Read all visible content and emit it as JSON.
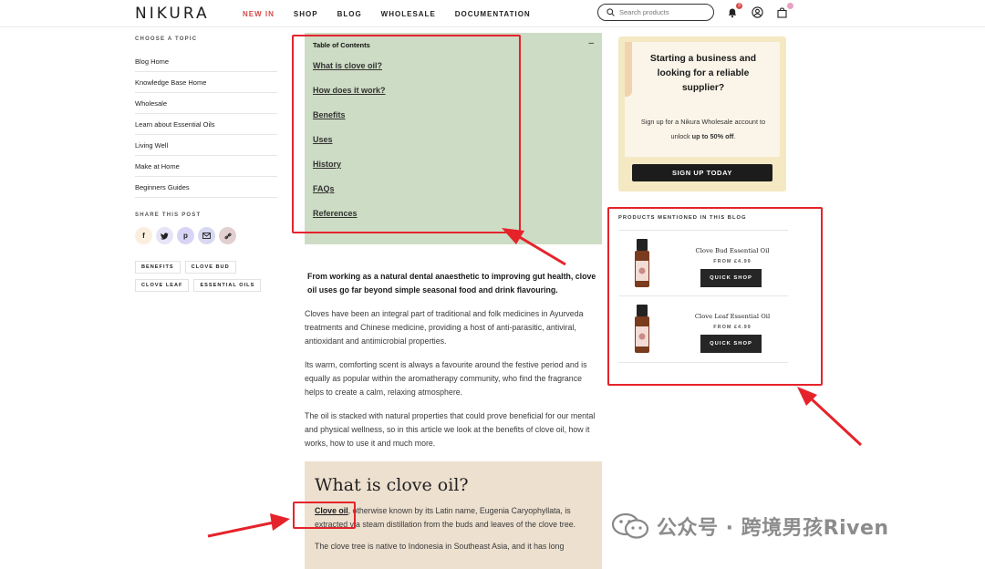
{
  "header": {
    "logo": "NIKURA",
    "nav": [
      {
        "label": "NEW IN",
        "active": true
      },
      {
        "label": "SHOP",
        "active": false
      },
      {
        "label": "BLOG",
        "active": false
      },
      {
        "label": "WHOLESALE",
        "active": false
      },
      {
        "label": "DOCUMENTATION",
        "active": false
      }
    ],
    "search_placeholder": "Search products",
    "notification_count": "3",
    "accent_color": "#d64a4a"
  },
  "sidebar": {
    "topic_heading": "CHOOSE A TOPIC",
    "topics": [
      "Blog Home",
      "Knowledge Base Home",
      "Wholesale",
      "Learn about Essential Oils",
      "Living Well",
      "Make at Home",
      "Beginners Guides"
    ],
    "share_heading": "SHARE THIS POST",
    "share_icons": [
      "facebook-icon",
      "twitter-icon",
      "pinterest-icon",
      "email-icon",
      "link-icon"
    ],
    "tags": [
      "BENEFITS",
      "CLOVE BUD",
      "CLOVE LEAF",
      "ESSENTIAL OILS"
    ]
  },
  "toc": {
    "title": "Table of Contents",
    "collapse": "–",
    "links": [
      "What is clove oil?",
      "How does it work?",
      "Benefits",
      "Uses",
      "History",
      "FAQs",
      "References"
    ],
    "background": "#cddcc4"
  },
  "article": {
    "lead": "From working as a natural dental anaesthetic to improving gut health, clove oil uses go far beyond simple seasonal food and drink flavouring.",
    "paragraphs": [
      "Cloves have been an integral part of traditional and folk medicines in Ayurveda treatments and Chinese medicine, providing a host of anti-parasitic, antiviral, antioxidant and antimicrobial properties.",
      "Its warm, comforting scent is always a favourite around the festive period and is equally as popular within the aromatherapy community, who find the fragrance helps to create a calm, relaxing atmosphere.",
      "The oil is stacked with natural properties that could prove beneficial for our mental and physical wellness, so in this article we look at the benefits of clove oil, how it works, how to use it and much more."
    ],
    "section_title": "What is clove oil?",
    "section_link": "Clove oil",
    "section_text": ", otherwise known by its Latin name, Eugenia Caryophyllata, is extracted via steam distillation from the buds and leaves of the clove tree.",
    "section_text2": "The clove tree is native to Indonesia in Southeast Asia, and it has long"
  },
  "promo": {
    "heading": "Starting a business and looking for a reliable supplier?",
    "text_1": "Sign up for a Nikura Wholesale account to unlock ",
    "text_bold": "up to 50% off",
    "text_2": ".",
    "button": "SIGN UP TODAY"
  },
  "products": {
    "heading": "PRODUCTS MENTIONED IN THIS BLOG",
    "items": [
      {
        "name": "Clove Bud Essential Oil",
        "price": "FROM £4.99",
        "button": "QUICK SHOP"
      },
      {
        "name": "Clove Leaf Essential Oil",
        "price": "FROM £4.99",
        "button": "QUICK SHOP"
      }
    ]
  },
  "annotation_color": "#e5232b",
  "watermark": "公众号 · 跨境男孩Riven"
}
